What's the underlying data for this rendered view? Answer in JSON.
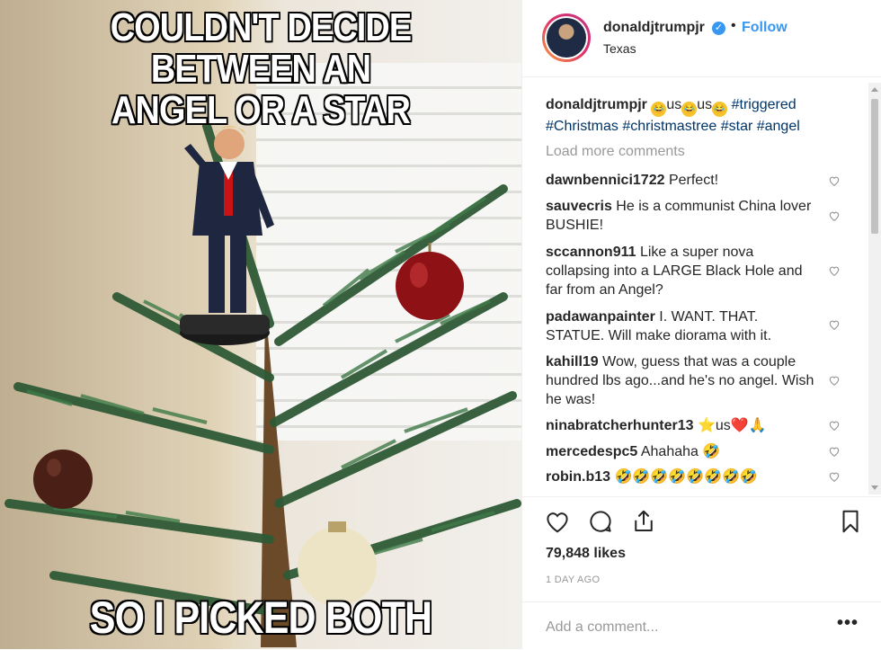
{
  "photo": {
    "top_text_line1": "COULDN'T DECIDE BETWEEN AN",
    "top_text_line2": "ANGEL OR A STAR",
    "bottom_text": "SO I PICKED BOTH"
  },
  "header": {
    "username": "donaldjtrumpjr",
    "verified_mark": "✓",
    "separator": "•",
    "follow_label": "Follow",
    "location": "Texas"
  },
  "caption": {
    "username": "donaldjtrumpjr",
    "emoji_1": "🤣",
    "text_1": "us",
    "emoji_2": "🤣",
    "text_2": "us",
    "emoji_3": "🤣",
    "hashtags_line1": "#triggered",
    "hashtags_line2": "#Christmas #christmastree #star #angel"
  },
  "load_more_label": "Load more comments",
  "comments": [
    {
      "user": "dawnbennici1722",
      "text": "Perfect!"
    },
    {
      "user": "sauvecris",
      "text": "He is a communist China lover BUSHIE!"
    },
    {
      "user": "sccannon911",
      "text": "Like a super nova collapsing into a LARGE Black Hole and far from an Angel?"
    },
    {
      "user": "padawanpainter",
      "text": "I. WANT. THAT. STATUE. Will make diorama with it."
    },
    {
      "user": "kahill19",
      "text": "Wow, guess that was a couple hundred lbs ago...and he's no angel. Wish he was!"
    },
    {
      "user": "ninabratcherhunter13",
      "text": "⭐us❤️🙏"
    },
    {
      "user": "mercedespc5",
      "text": "Ahahaha 🤣"
    },
    {
      "user": "robin.b13",
      "text": "🤣🤣🤣🤣🤣🤣🤣🤣"
    }
  ],
  "likes": "79,848 likes",
  "time_ago": "1 DAY AGO",
  "add_comment_placeholder": "Add a comment...",
  "more_options": "•••",
  "colors": {
    "link": "#3897f0",
    "hashtag": "#003569",
    "muted": "#999999",
    "text": "#262626"
  }
}
